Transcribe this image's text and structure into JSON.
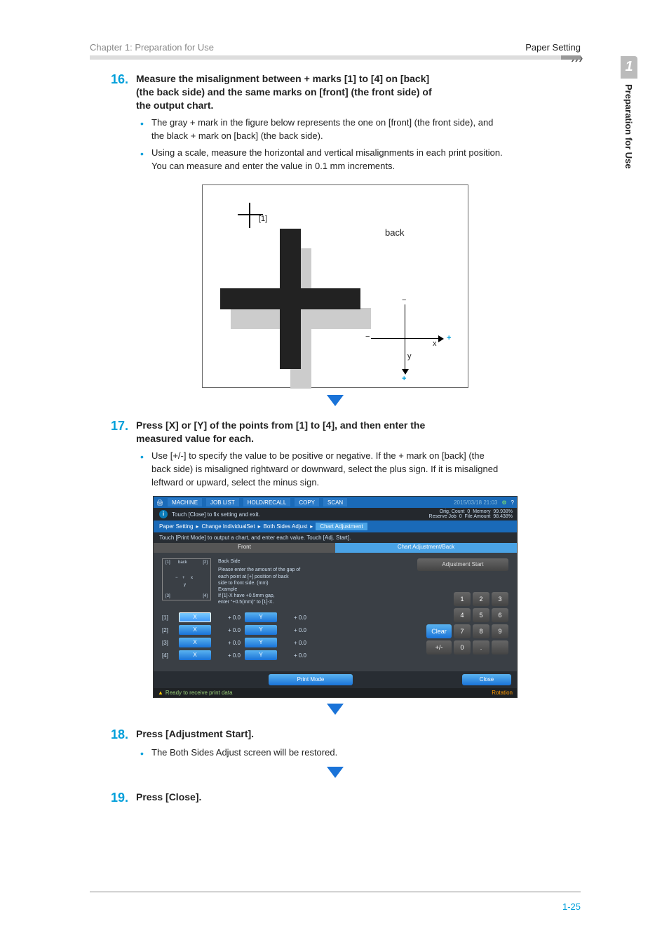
{
  "header": {
    "left": "Chapter 1: Preparation for Use",
    "right": "Paper Setting"
  },
  "sideTab": {
    "num": "1",
    "label": "Preparation for Use"
  },
  "steps": {
    "s16": {
      "num": "16.",
      "title": "Measure the misalignment between + marks [1] to [4] on [back] (the back side) and the same marks on [front] (the front side) of the output chart.",
      "bullets": [
        "The gray + mark in the figure below represents the one on [front] (the front side), and the black + mark on [back] (the back side).",
        "Using a scale, measure the horizontal and vertical misalignments in each print position. You can measure and enter the value in 0.1 mm increments."
      ]
    },
    "s17": {
      "num": "17.",
      "title": "Press [X] or [Y] of the points from [1] to [4], and then enter the measured value for each.",
      "bullets": [
        "Use [+/-] to specify the value to be positive or negative. If the + mark on [back] (the back side) is misaligned rightward or downward, select the plus sign. If it is misaligned leftward or upward, select the minus sign."
      ]
    },
    "s18": {
      "num": "18.",
      "title": "Press [Adjustment Start].",
      "bullets": [
        "The Both Sides Adjust screen will be restored."
      ]
    },
    "s19": {
      "num": "19.",
      "title": "Press [Close]."
    }
  },
  "fig1": {
    "one": "[1]",
    "back": "back",
    "x": "x",
    "y": "y",
    "plus": "+",
    "minus": "−"
  },
  "screen": {
    "topbar": {
      "machine": "MACHINE",
      "joblist": "JOB LIST",
      "recall": "HOLD/RECALL",
      "copy": "COPY",
      "scan": "SCAN",
      "datetime": "2015/03/18 21:03",
      "gear": "⚙",
      "help": "?"
    },
    "info": "Touch [Close] to fix setting and exit.",
    "status": {
      "orig": "Orig. Count",
      "origv": "0",
      "mem": "Memory",
      "memv": "99.938%",
      "resv": "Reserve Job",
      "resvv": "0",
      "file": "File Amount",
      "filev": "98.438%"
    },
    "crumb": {
      "a": "Paper Setting",
      "b": "Change IndividualSet",
      "c": "Both Sides Adjust",
      "d": "Chart Adjustment"
    },
    "instr": "Touch [Print Mode] to output a chart, and enter each value. Touch [Adj. Start].",
    "tabs": {
      "front": "Front",
      "back": "Chart Adjustment/Back"
    },
    "desc": {
      "bkside": "Back Side",
      "line1": "Please enter the amount of the gap of",
      "line2": "each point at [+] position of back",
      "line3": "side to front side. (mm)",
      "ex": "Example",
      "line4": "If [1]-X have +0.5mm gap,",
      "line5": "enter \"+0.5(mm)\" to [1]-X."
    },
    "mini": {
      "p1": "[1]",
      "p2": "[2]",
      "p3": "[3]",
      "p4": "[4]",
      "back": "back",
      "x": "x",
      "y": "y"
    },
    "rows": [
      {
        "lbl": "[1]",
        "x": "X",
        "xv": "+ 0.0",
        "y": "Y",
        "yv": "+ 0.0"
      },
      {
        "lbl": "[2]",
        "x": "X",
        "xv": "+ 0.0",
        "y": "Y",
        "yv": "+ 0.0"
      },
      {
        "lbl": "[3]",
        "x": "X",
        "xv": "+ 0.0",
        "y": "Y",
        "yv": "+ 0.0"
      },
      {
        "lbl": "[4]",
        "x": "X",
        "xv": "+ 0.0",
        "y": "Y",
        "yv": "+ 0.0"
      }
    ],
    "adjStart": "Adjustment Start",
    "keys": [
      "1",
      "2",
      "3",
      "4",
      "5",
      "6",
      "Clear",
      "7",
      "8",
      "9",
      "+/-",
      "0",
      ".",
      " "
    ],
    "printMode": "Print Mode",
    "close": "Close",
    "ready": "Ready to receive print data",
    "rotation": "Rotation"
  },
  "pageNum": "1-25"
}
